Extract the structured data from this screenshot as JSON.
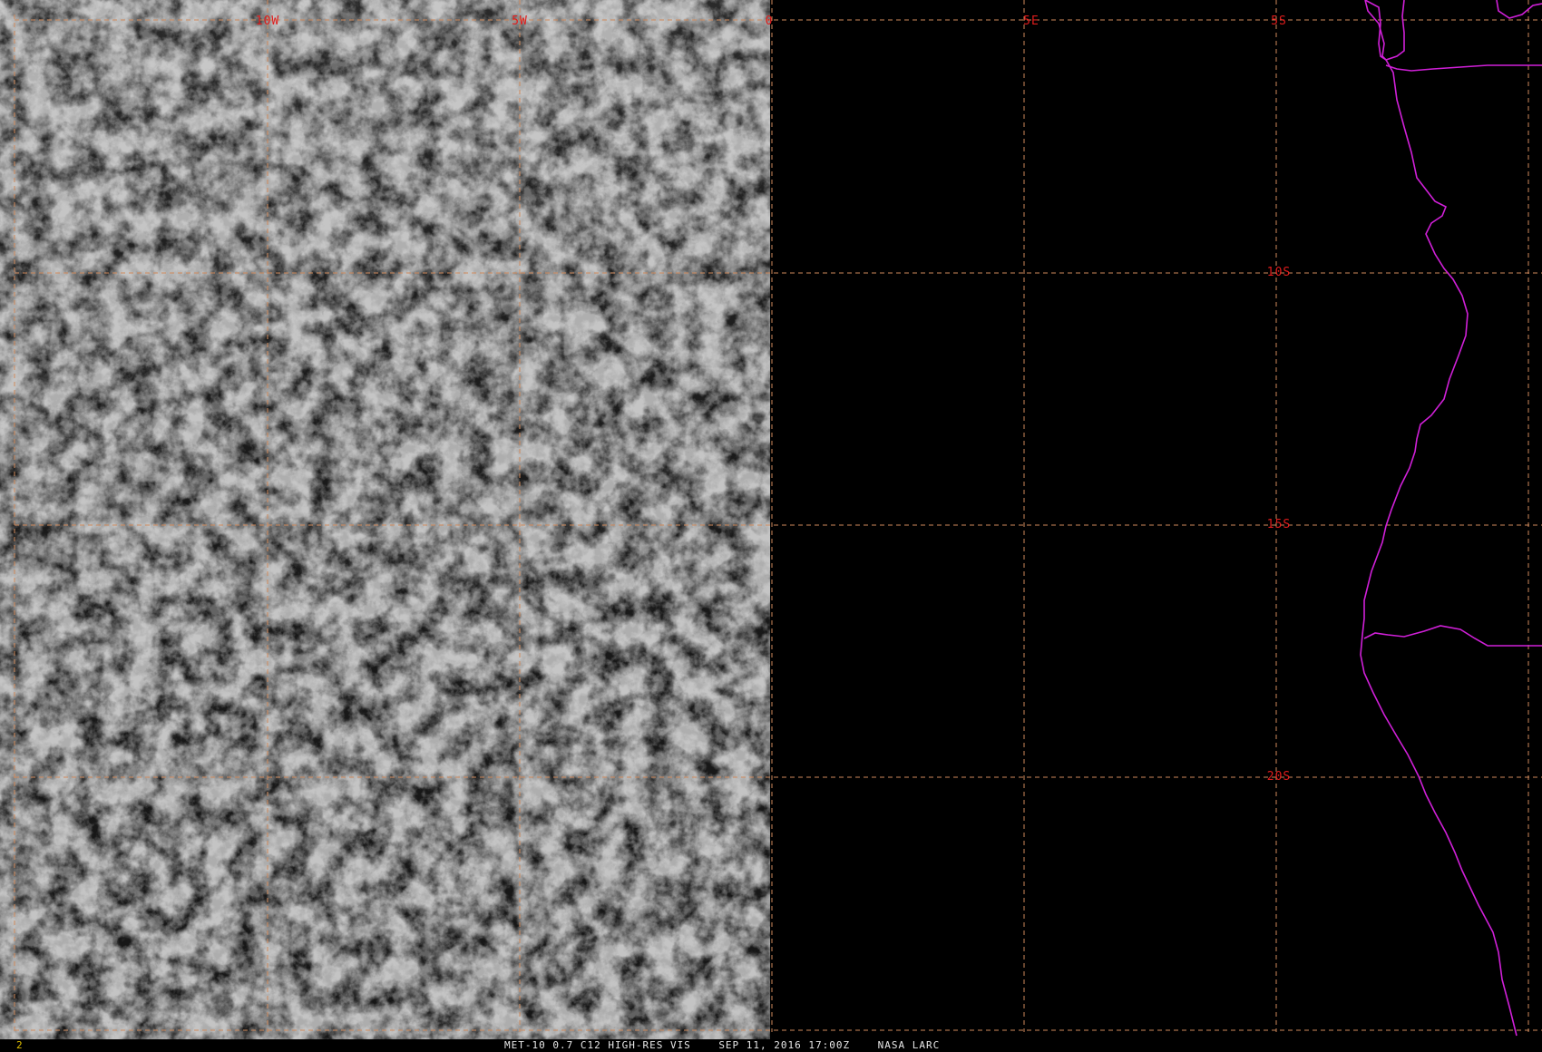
{
  "image": {
    "satellite_product": "MET-10 0.7 C12 HIGH-RES VIS",
    "timestamp": "SEP 11, 2016 17:00Z",
    "credit": "NASA LARC",
    "frame_number": "2"
  },
  "grid": {
    "longitude_labels": [
      "10W",
      "5W",
      "0",
      "5E"
    ],
    "latitude_labels": [
      "5S",
      "10S",
      "15S",
      "20S"
    ],
    "line_color": "#d08a5c",
    "label_color": "#e01c1c"
  },
  "colors": {
    "coastline": "#d020d8",
    "background": "#000000",
    "cloud_bright": "#d6d6d6",
    "ocean_dark": "#161616",
    "footer_text": "#e8e8e8",
    "frame_number": "#e0c000"
  },
  "layers": {
    "visible_imagery": "cloud-field-west-of-0",
    "no_data_region": "east-of-0",
    "coastline": "africa-west-coast"
  }
}
